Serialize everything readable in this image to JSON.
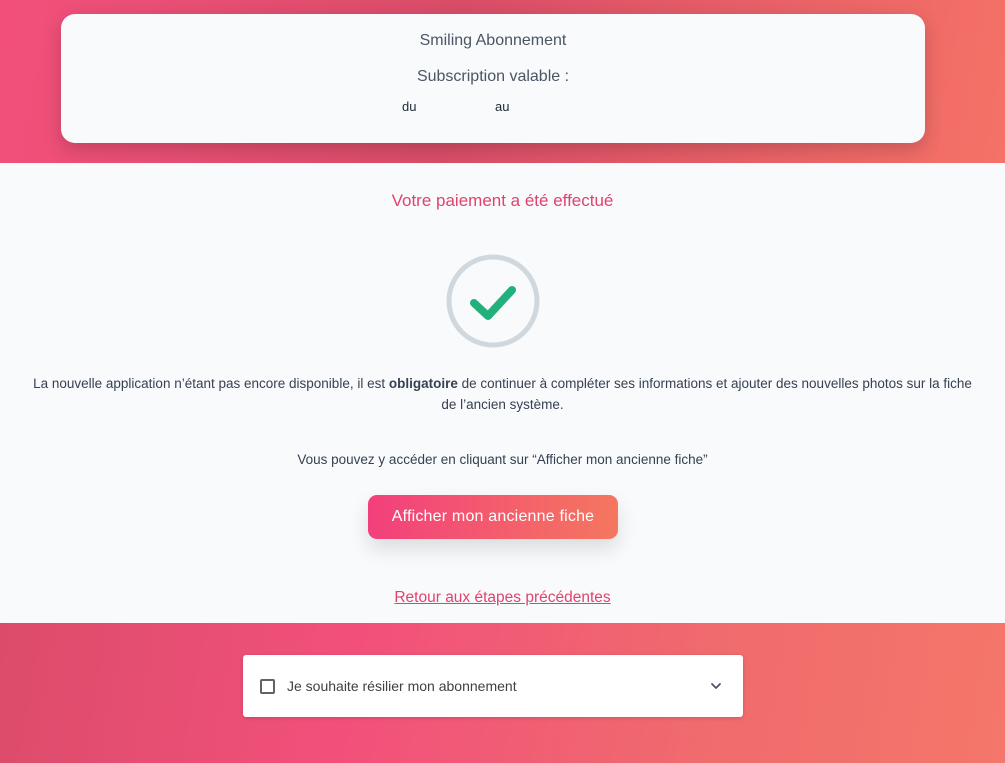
{
  "subscription": {
    "title": "Smiling Abonnement",
    "valid_label": "Subscription valable :",
    "from_label": "du",
    "to_label": "au"
  },
  "payment": {
    "title": "Votre paiement a été effectué",
    "info_before": "La nouvelle application n’étant pas encore disponible, il est ",
    "info_bold": "obligatoire",
    "info_after": " de continuer à compléter ses informations et ajouter des nouvelles photos sur la fiche de l’ancien système.",
    "access_text": "Vous pouvez y accéder en cliquant sur “Afficher mon ancienne fiche”",
    "button_label": "Afficher mon ancienne fiche",
    "back_link": "Retour aux étapes précédentes"
  },
  "cancellation": {
    "checkbox_label": "Je souhaite résilier mon abonnement",
    "checked": false
  },
  "icons": {
    "success": "check-circle-icon",
    "expand": "chevron-down-icon"
  },
  "colors": {
    "accent": "#e0436d",
    "success_check": "#22b07d",
    "gradient_start": "#f23f7c",
    "gradient_end": "#f5775f"
  }
}
